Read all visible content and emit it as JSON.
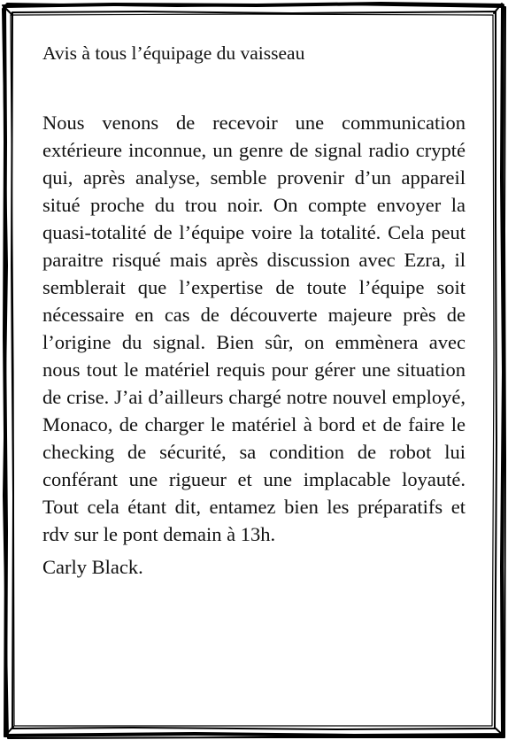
{
  "letter": {
    "greeting": "Avis à tous l’équipage du vaisseau",
    "body": "Nous venons de recevoir une communication extérieure inconnue, un genre de signal radio crypté qui, après analyse, semble provenir d’un appareil situé proche du trou noir. On compte envoyer la quasi-totalité de l’équipe voire la totalité. Cela peut paraitre risqué mais après discussion avec Ezra, il semblerait que l’expertise de toute l’équipe soit nécessaire en cas de découverte majeure près de l’origine du signal. Bien sûr, on emmènera avec nous tout le matériel requis pour gérer une situation de crise. J’ai d’ailleurs chargé notre nouvel employé, Monaco, de charger le matériel à bord et de faire le checking de sécurité, sa condition de robot lui conférant une rigueur et une implacable loyauté. Tout cela étant dit, entamez bien les préparatifs et rdv sur le pont demain à 13h.",
    "signature": "Carly Black."
  },
  "colors": {
    "ink": "#111111",
    "paper": "#ffffff",
    "border": "#000000"
  }
}
